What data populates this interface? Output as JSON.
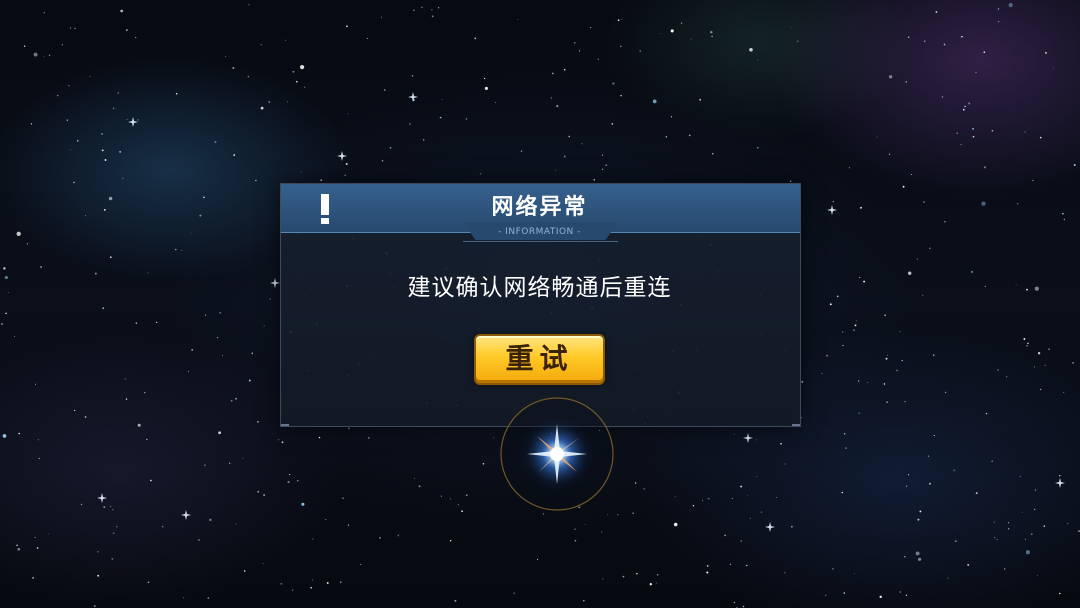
{
  "dialog": {
    "title": "网络异常",
    "subtitle": "- INFORMATION -",
    "message": "建议确认网络畅通后重连",
    "retry_label": "重试"
  },
  "icons": {
    "alert": "exclamation-icon"
  },
  "colors": {
    "header": "#36618e",
    "button": "#ffc928",
    "background": "#05070d"
  }
}
